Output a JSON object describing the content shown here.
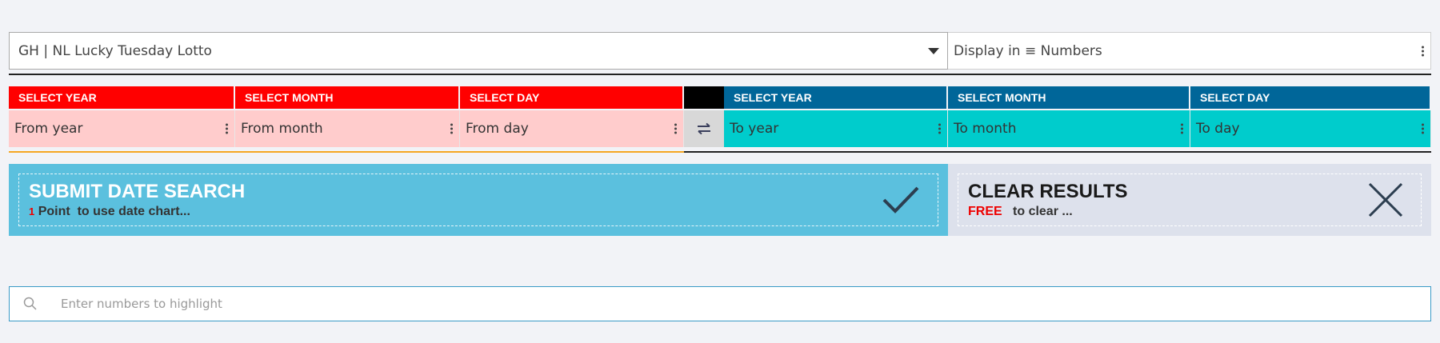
{
  "game_select": {
    "value": "GH | NL Lucky Tuesday Lotto"
  },
  "display_select": {
    "value": "Display in ≡ Numbers"
  },
  "from": {
    "year_header": "SELECT YEAR",
    "year_value": "From year",
    "month_header": "SELECT MONTH",
    "month_value": "From month",
    "day_header": "SELECT DAY",
    "day_value": "From day"
  },
  "to": {
    "year_header": "SELECT YEAR",
    "year_value": "To year",
    "month_header": "SELECT MONTH",
    "month_value": "To month",
    "day_header": "SELECT DAY",
    "day_value": "To day"
  },
  "submit": {
    "title": "SUBMIT DATE SEARCH",
    "cost_num": "1",
    "cost_label": "Point",
    "desc": "to use date chart..."
  },
  "clear": {
    "title": "CLEAR RESULTS",
    "cost": "FREE",
    "desc": "to clear ..."
  },
  "search": {
    "placeholder": "Enter numbers to highlight"
  },
  "icons": {
    "swap": "swap-arrows-icon",
    "check": "checkmark-icon",
    "close": "close-icon",
    "search": "search-icon",
    "kebab": "kebab-menu-icon",
    "caret": "caret-down-icon"
  },
  "colors": {
    "from_header": "#ff0000",
    "from_field": "#ffcccc",
    "to_header": "#006699",
    "to_field": "#00cccc",
    "submit_bg": "#5bc0de",
    "clear_bg": "#dde1ec"
  }
}
